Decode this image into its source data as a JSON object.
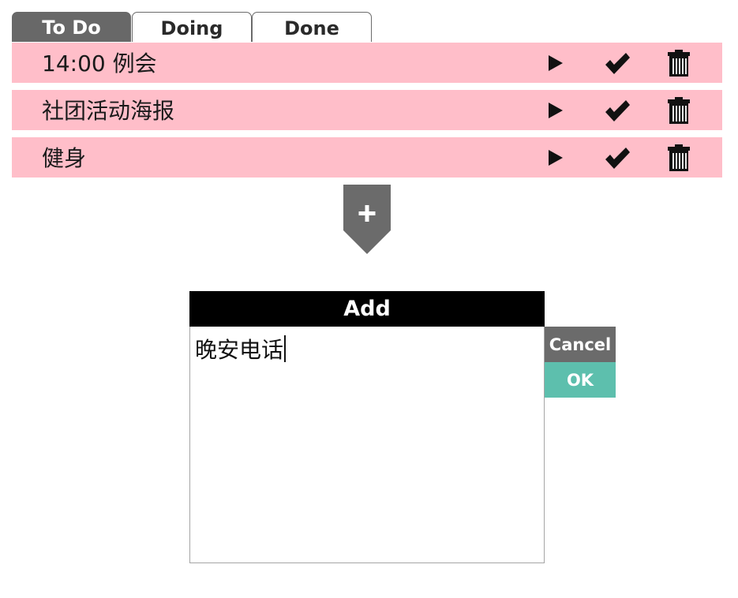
{
  "tabs": [
    {
      "label": "To Do",
      "active": true
    },
    {
      "label": "Doing",
      "active": false
    },
    {
      "label": "Done",
      "active": false
    }
  ],
  "tasks": [
    {
      "label": "14:00 例会",
      "actions": [
        "play-icon",
        "check-icon",
        "trash-icon"
      ]
    },
    {
      "label": "社团活动海报",
      "actions": [
        "play-icon",
        "check-icon",
        "trash-icon"
      ]
    },
    {
      "label": "健身",
      "actions": [
        "play-icon",
        "check-icon",
        "trash-icon"
      ]
    }
  ],
  "add_toggle": {
    "icon": "plus-icon"
  },
  "dialog": {
    "title": "Add",
    "input_value": "晚安电话",
    "cancel_label": "Cancel",
    "ok_label": "OK"
  },
  "colors": {
    "task_bg": "#ffbec9",
    "tab_active_bg": "#686868",
    "toggle_bg": "#6b6b6b",
    "dialog_header_bg": "#000000",
    "cancel_bg": "#6b6b6b",
    "ok_bg": "#5dbfad"
  }
}
